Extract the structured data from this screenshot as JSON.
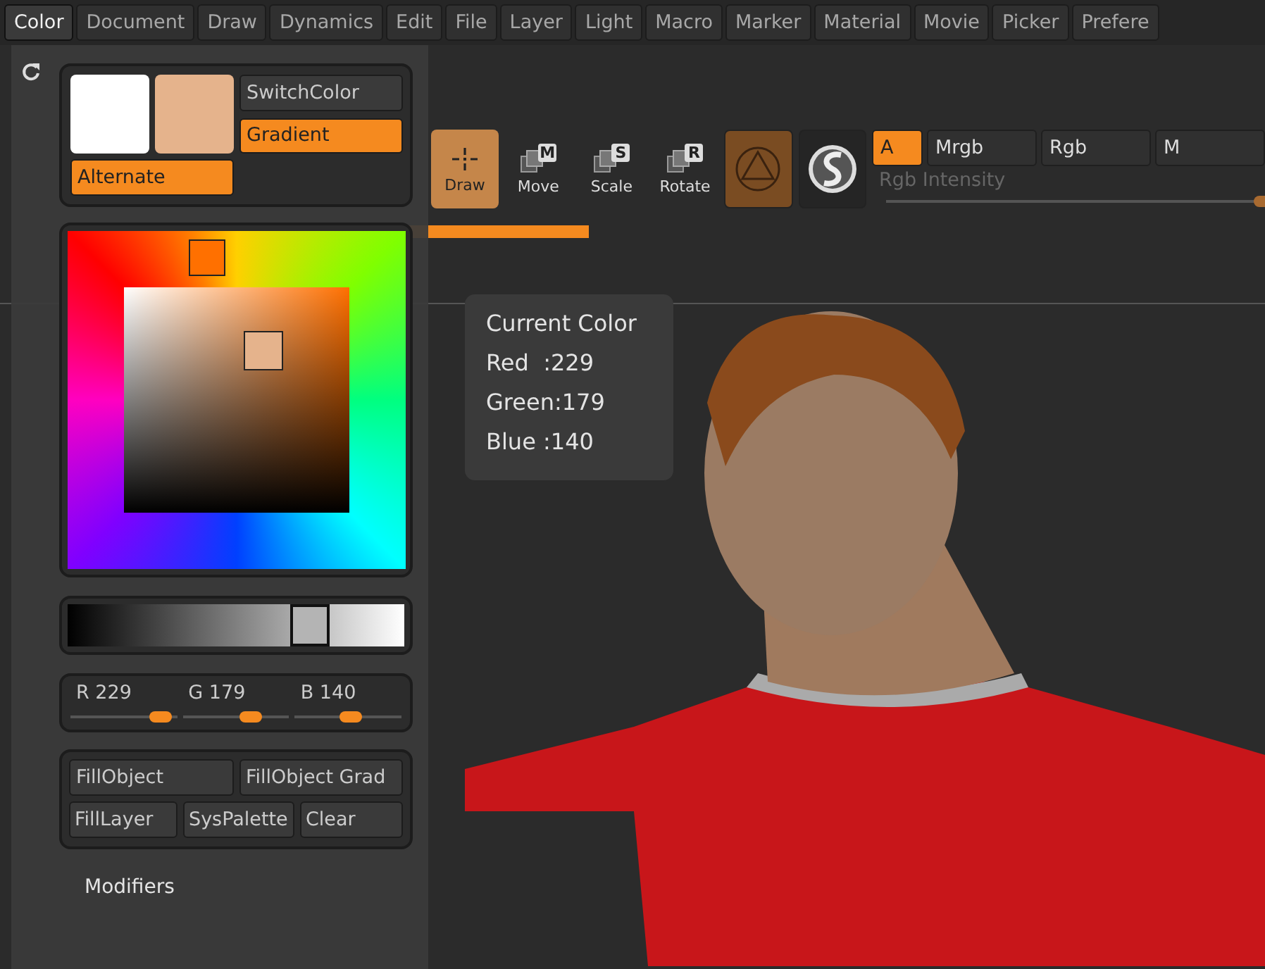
{
  "menu_bar": [
    {
      "label": "Color",
      "selected": true
    },
    {
      "label": "Document",
      "selected": false
    },
    {
      "label": "Draw",
      "selected": false
    },
    {
      "label": "Dynamics",
      "selected": false
    },
    {
      "label": "Edit",
      "selected": false
    },
    {
      "label": "File",
      "selected": false
    },
    {
      "label": "Layer",
      "selected": false
    },
    {
      "label": "Light",
      "selected": false
    },
    {
      "label": "Macro",
      "selected": false
    },
    {
      "label": "Marker",
      "selected": false
    },
    {
      "label": "Material",
      "selected": false
    },
    {
      "label": "Movie",
      "selected": false
    },
    {
      "label": "Picker",
      "selected": false
    },
    {
      "label": "Prefere",
      "selected": false
    }
  ],
  "toolbar": {
    "tools": [
      {
        "label": "Draw",
        "selected": true
      },
      {
        "label": "Move",
        "shortcut": "M",
        "selected": false
      },
      {
        "label": "Scale",
        "shortcut": "S",
        "selected": false
      },
      {
        "label": "Rotate",
        "shortcut": "R",
        "selected": false
      }
    ],
    "modes": [
      {
        "label": "A",
        "selected": true
      },
      {
        "label": "Mrgb",
        "selected": false
      },
      {
        "label": "Rgb",
        "selected": false
      },
      {
        "label": "M",
        "selected": false
      }
    ],
    "intensity_label": "Rgb Intensity",
    "intensity": {
      "level": 1
    }
  },
  "color_panel": {
    "switch_button": "SwitchColor",
    "toggles": [
      {
        "label": "Gradient",
        "on": true
      },
      {
        "label": "Alternate",
        "on": true
      }
    ],
    "gray_slider": {
      "level": 0.72
    },
    "channels": [
      {
        "label": "R",
        "value": "229",
        "level": 0.84
      },
      {
        "label": "G",
        "value": "179",
        "level": 0.64
      },
      {
        "label": "B",
        "value": "140",
        "level": 0.53
      }
    ],
    "buttons": [
      "FillObject",
      "FillObject Grad",
      "FillLayer",
      "SysPalette",
      "Clear"
    ],
    "section": "Modifiers"
  },
  "tooltip": {
    "title": "Current Color",
    "lines": [
      "Red  :229",
      "Green:179",
      "Blue :140"
    ]
  }
}
